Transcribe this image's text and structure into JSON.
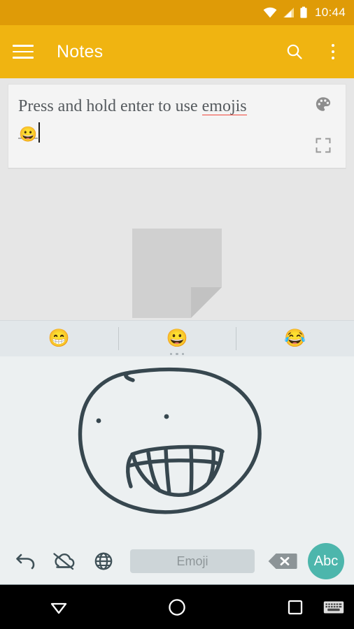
{
  "status_bar": {
    "time": "10:44",
    "icons": [
      "wifi-icon",
      "cellular-signal-icon",
      "battery-icon"
    ],
    "background": "#DF9B07"
  },
  "app_bar": {
    "title": "Notes",
    "menu_icon": "hamburger-menu-icon",
    "search_icon": "search-icon",
    "overflow_icon": "overflow-menu-icon",
    "background": "#F0B411"
  },
  "note": {
    "text_line1": "Press and hold enter to use",
    "text_word_misspelled": "emojis",
    "text_emoji": "😀",
    "palette_icon": "color-palette-icon",
    "expand_icon": "fullscreen-expand-icon",
    "spellcheck_underline_color": "#F0453A",
    "card_background": "#F4F4F4"
  },
  "empty_state": {
    "icon": "note-paper-placeholder-icon",
    "fill": "#D0D0D0",
    "fold_fill": "#C2C2C2"
  },
  "keyboard": {
    "suggestions": [
      {
        "name": "suggestion-beaming-face",
        "glyph": "😁"
      },
      {
        "name": "suggestion-grinning-face",
        "glyph": "😀"
      },
      {
        "name": "suggestion-tears-of-joy",
        "glyph": "😂"
      }
    ],
    "more_indicator": "three-dots-indicator",
    "drawing": "hand-drawn-smiley-face",
    "toolbar": {
      "undo_icon": "undo-icon",
      "cloud_off_icon": "cloud-off-icon",
      "globe_icon": "language-globe-icon",
      "space_key_label": "Emoji",
      "backspace_icon": "backspace-delete-icon",
      "abc_key_label": "Abc",
      "abc_key_color": "#4DB6AC"
    },
    "background": "#ECF0F1",
    "suggestion_strip_background": "#E2E7EA"
  },
  "nav_bar": {
    "back_icon": "hide-keyboard-down-arrow-icon",
    "home_icon": "home-circle-icon",
    "recents_icon": "recents-square-icon",
    "keyboard_indicator_icon": "keyboard-indicator-icon",
    "background": "#000000"
  }
}
